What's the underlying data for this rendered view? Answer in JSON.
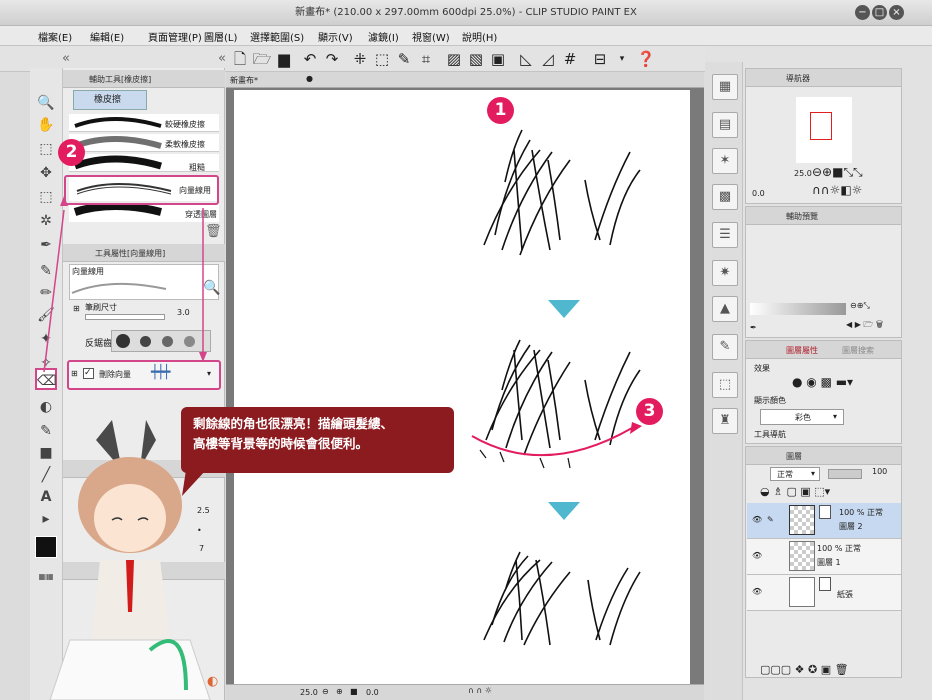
{
  "window": {
    "title": "新畫布* (210.00 x 297.00mm 600dpi 25.0%) - CLIP STUDIO PAINT EX"
  },
  "menu": [
    "檔案(E)",
    "編輯(E)",
    "頁面管理(P)",
    "圖層(L)",
    "選擇範圍(S)",
    "顯示(V)",
    "濾鏡(I)",
    "視窗(W)",
    "說明(H)"
  ],
  "subtool_panel": {
    "tab_label": "輔助工具[橡皮擦]",
    "group_label": "橡皮擦",
    "items": [
      "較硬橡皮擦",
      "柔軟橡皮擦",
      "粗糙",
      "向量線用",
      "穿透圖層"
    ]
  },
  "tool_property": {
    "tab_label": "工具屬性[向量線用]",
    "header": "向量線用",
    "brush_size_label": "筆刷尺寸",
    "brush_size_value": "3.0",
    "antialias_label": "反鋸齒",
    "delete_vector_label": "刪除向量"
  },
  "canvas": {
    "tab_label": "新畫布*",
    "zoom": "25.0",
    "rotation": "0.0"
  },
  "color_panel": {
    "values": [
      "2.5",
      "7"
    ]
  },
  "navigator": {
    "tab_label": "導航器",
    "zoom": "25.0",
    "angle": "0.0"
  },
  "sub_view": {
    "tab_label": "輔助預覽"
  },
  "layer_property": {
    "tab_label": "圖層屬性",
    "search_tab": "圖層搜索",
    "effect_label": "效果",
    "display_color_label": "顯示顏色",
    "color_option": "彩色",
    "guide_label": "工具導航"
  },
  "layers": {
    "tab_label": "圖層",
    "blend_mode": "正常",
    "opacity": "100",
    "items": [
      {
        "mode": "100 % 正常",
        "name": "圖層 2"
      },
      {
        "mode": "100 % 正常",
        "name": "圖層 1"
      },
      {
        "mode": "",
        "name": "紙張"
      }
    ]
  },
  "annotations": {
    "callout_line1": "剩餘線的角也很漂亮！描繪頭髮縷、",
    "callout_line2": "高樓等背景等的時候會很便利。",
    "badge1": "1",
    "badge2": "2",
    "badge3": "3"
  },
  "colors": {
    "badge": "#e31c5f",
    "callout": "#8c1b20",
    "arrow": "#4fb8cf"
  }
}
